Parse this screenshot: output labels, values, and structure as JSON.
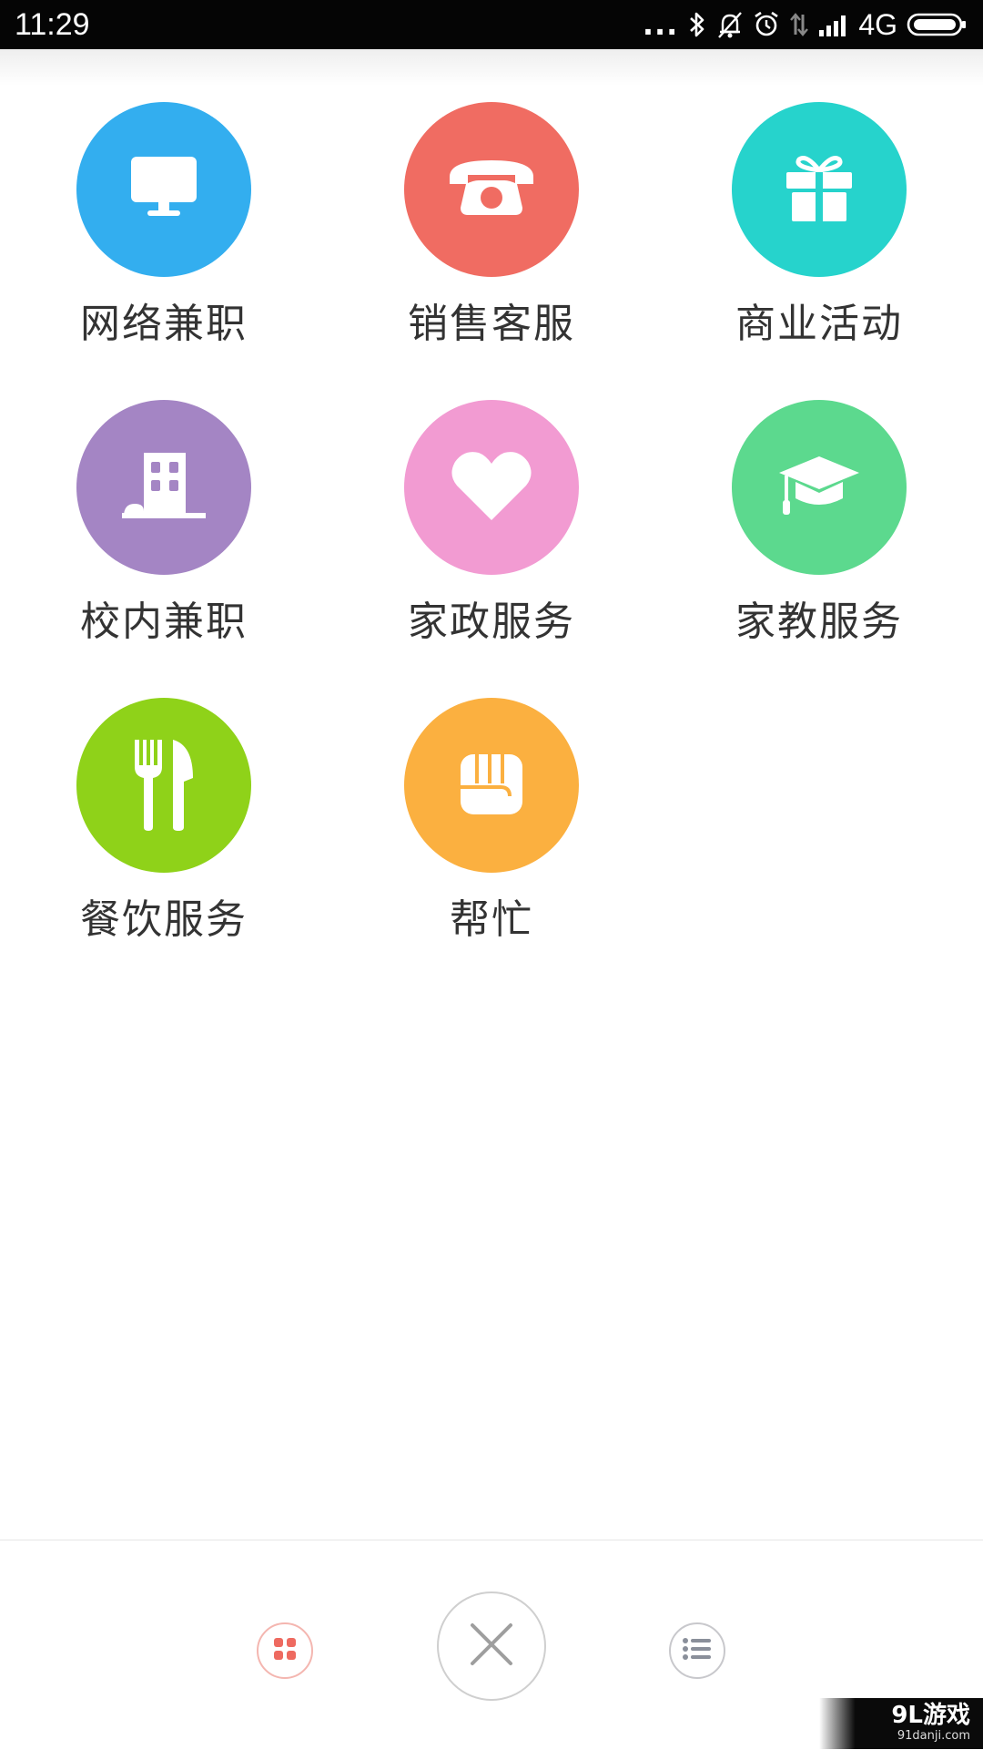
{
  "status_bar": {
    "time": "11:29",
    "dots": "...",
    "network": "4G",
    "icons": [
      "bluetooth-icon",
      "mute-icon",
      "alarm-icon",
      "data-arrows-icon",
      "signal-icon",
      "battery-icon"
    ]
  },
  "categories": [
    {
      "label": "网络兼职",
      "icon": "computer-monitor-icon",
      "color": "#33AEEF"
    },
    {
      "label": "销售客服",
      "icon": "telephone-icon",
      "color": "#F06C62"
    },
    {
      "label": "商业活动",
      "icon": "gift-icon",
      "color": "#26D3CC"
    },
    {
      "label": "校内兼职",
      "icon": "building-icon",
      "color": "#A485C4"
    },
    {
      "label": "家政服务",
      "icon": "heart-icon",
      "color": "#F29BD2"
    },
    {
      "label": "家教服务",
      "icon": "graduation-cap-icon",
      "color": "#5CD98E"
    },
    {
      "label": "餐饮服务",
      "icon": "fork-knife-icon",
      "color": "#8FD219"
    },
    {
      "label": "帮忙",
      "icon": "fist-icon",
      "color": "#FBB040"
    }
  ],
  "bottom_bar": {
    "buttons": [
      "grid-icon",
      "close-icon",
      "list-icon"
    ]
  },
  "watermark": {
    "main": "9L游戏",
    "sub": "91danji.com"
  }
}
